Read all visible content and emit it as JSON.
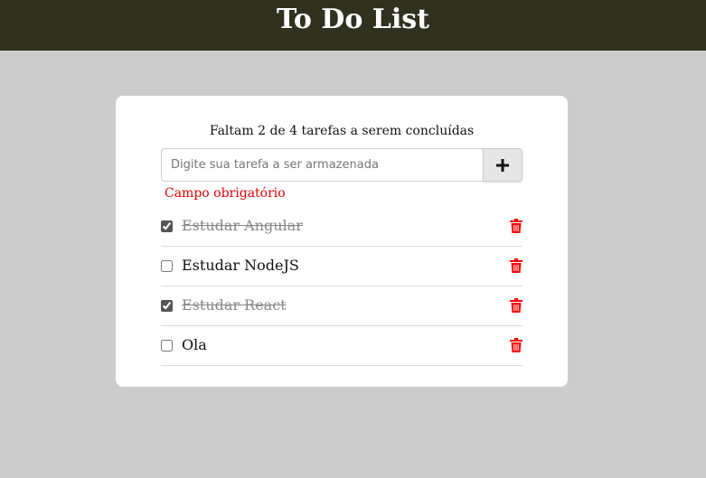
{
  "header": {
    "title": "To Do List"
  },
  "card": {
    "summary": "Faltam 2 de 4 tarefas a serem concluídas",
    "input": {
      "placeholder": "Digite sua tarefa a ser armazenada",
      "value": ""
    },
    "add_button_icon": "plus-icon",
    "error": "Campo obrigatório",
    "tasks": [
      {
        "label": "Estudar Angular",
        "done": true,
        "delete_icon": "trash-icon"
      },
      {
        "label": "Estudar NodeJS",
        "done": false,
        "delete_icon": "trash-icon"
      },
      {
        "label": "Estudar React",
        "done": true,
        "delete_icon": "trash-icon"
      },
      {
        "label": "Ola",
        "done": false,
        "delete_icon": "trash-icon"
      }
    ]
  },
  "colors": {
    "header_bg": "#313120",
    "page_bg": "#cccccc",
    "error": "#e00000",
    "delete_icon": "#ff0000"
  }
}
